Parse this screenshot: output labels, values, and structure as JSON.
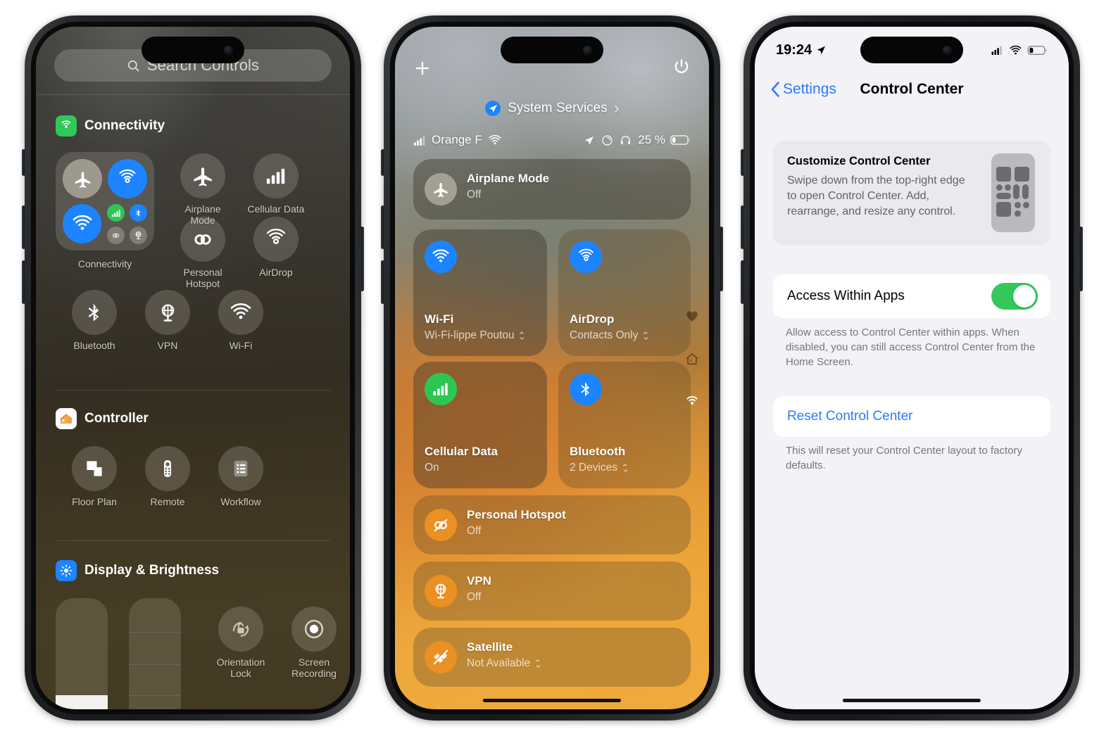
{
  "phone1": {
    "name": "control-center-editor",
    "search": {
      "placeholder": "Search Controls",
      "icon": "search-icon"
    },
    "sections": [
      {
        "title": "Connectivity",
        "icon": "connectivity-icon",
        "icon_color": "#31c759",
        "group_tile_label": "Connectivity",
        "controls": [
          {
            "label": "Airplane\nMode",
            "icon": "airplane-icon"
          },
          {
            "label": "Cellular Data",
            "icon": "cellular-bars-icon"
          },
          {
            "label": "Personal\nHotspot",
            "icon": "hotspot-link-icon"
          },
          {
            "label": "AirDrop",
            "icon": "airdrop-icon"
          },
          {
            "label": "Bluetooth",
            "icon": "bluetooth-icon"
          },
          {
            "label": "VPN",
            "icon": "vpn-globe-icon"
          },
          {
            "label": "Wi-Fi",
            "icon": "wifi-icon"
          }
        ]
      },
      {
        "title": "Controller",
        "icon": "home-app-icon",
        "icon_color": "#ffffff",
        "controls": [
          {
            "label": "Floor Plan",
            "icon": "floor-plan-icon"
          },
          {
            "label": "Remote",
            "icon": "remote-icon"
          },
          {
            "label": "Workflow",
            "icon": "workflow-list-icon"
          }
        ]
      },
      {
        "title": "Display & Brightness",
        "icon": "brightness-icon",
        "icon_color": "#1c84ff",
        "controls": [
          {
            "label": "Orientation\nLock",
            "icon": "orientation-lock-icon"
          },
          {
            "label": "Screen\nRecording",
            "icon": "screen-recording-icon"
          }
        ]
      }
    ]
  },
  "phone2": {
    "name": "control-center",
    "add_icon": "plus-icon",
    "power_icon": "power-icon",
    "service_pill": {
      "label": "System Services",
      "icon": "location-arrow-icon",
      "chevron": "›"
    },
    "status": {
      "signal_icon": "cellular-bars-icon",
      "carrier": "Orange F",
      "wifi_icon": "wifi-icon",
      "location_icon": "location-arrow-icon",
      "focus_icon": "focus-icon",
      "headphones_icon": "headphones-icon",
      "battery_pct": "25 %",
      "battery_icon": "battery-low-icon"
    },
    "tiles": [
      {
        "name": "Airplane Mode",
        "sub": "Off",
        "icon": "airplane-icon",
        "icon_bg": "grey",
        "shape": "wide",
        "chevron": false
      },
      {
        "name": "Wi-Fi",
        "sub": "Wi-Fi-lippe Poutou",
        "icon": "wifi-icon",
        "icon_bg": "blue",
        "shape": "square",
        "chevron": true
      },
      {
        "name": "AirDrop",
        "sub": "Contacts Only",
        "icon": "airdrop-icon",
        "icon_bg": "blue",
        "shape": "square",
        "chevron": true
      },
      {
        "name": "Cellular Data",
        "sub": "On",
        "icon": "cellular-bars-icon",
        "icon_bg": "green",
        "shape": "square",
        "chevron": false
      },
      {
        "name": "Bluetooth",
        "sub": "2 Devices",
        "icon": "bluetooth-icon",
        "icon_bg": "blue",
        "shape": "square",
        "chevron": true
      },
      {
        "name": "Personal Hotspot",
        "sub": "Off",
        "icon": "hotspot-link-icon",
        "icon_bg": "orange",
        "shape": "wide",
        "chevron": false
      },
      {
        "name": "VPN",
        "sub": "Off",
        "icon": "vpn-globe-icon",
        "icon_bg": "orange",
        "shape": "wide",
        "chevron": false
      },
      {
        "name": "Satellite",
        "sub": "Not Available",
        "icon": "satellite-icon",
        "icon_bg": "orange",
        "shape": "wide",
        "chevron": true
      }
    ],
    "page_indicators": [
      "heart-icon",
      "home-icon",
      "connectivity-icon"
    ]
  },
  "phone3": {
    "name": "settings-control-center",
    "status": {
      "time": "19:24",
      "location_icon": "location-arrow-icon",
      "signal_icon": "cellular-bars-icon",
      "wifi_icon": "wifi-icon",
      "battery_icon": "battery-low-icon"
    },
    "nav": {
      "back_label": "Settings",
      "back_icon": "chevron-left-icon",
      "title": "Control Center"
    },
    "info_card": {
      "heading": "Customize Control Center",
      "body": "Swipe down from the top-right edge to open Control Center. Add, rearrange, and resize any control.",
      "illustration": "control-center-preview-icon"
    },
    "toggle_row": {
      "label": "Access Within Apps",
      "state": "on",
      "on_color": "#34c759"
    },
    "toggle_footer": "Allow access to Control Center within apps. When disabled, you can still access Control Center from the Home Screen.",
    "reset_row": {
      "label": "Reset Control Center",
      "color": "#2a7cf6"
    },
    "reset_footer": "This will reset your Control Center layout to factory defaults."
  }
}
